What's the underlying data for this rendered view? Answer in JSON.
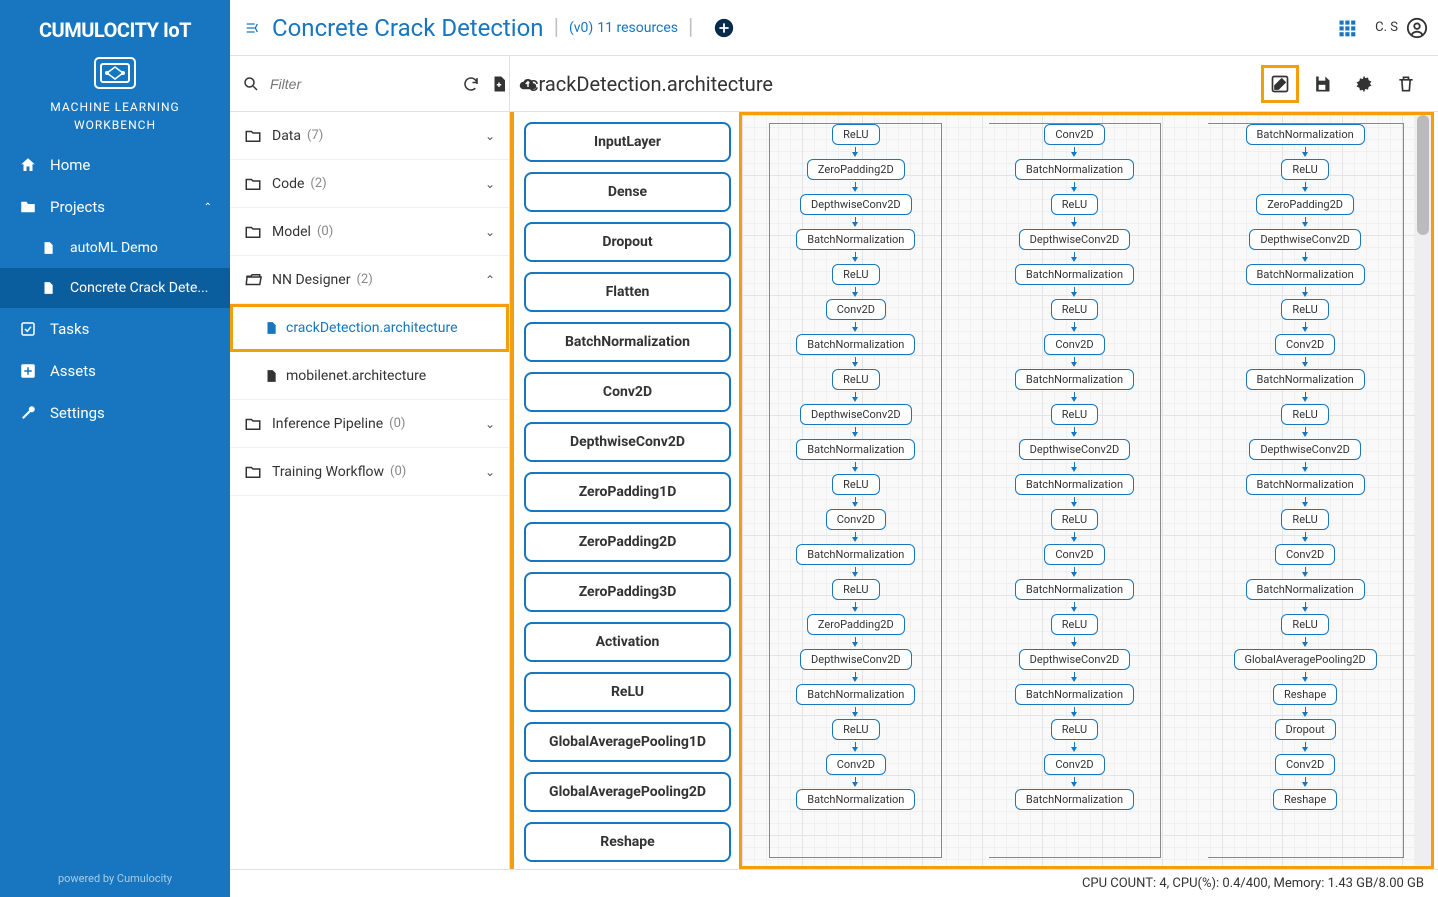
{
  "brand": {
    "line1": "CUMULOCITY",
    "line2": "IoT",
    "sub1": "MACHINE LEARNING",
    "sub2": "WORKBENCH"
  },
  "nav": {
    "home": "Home",
    "projects": "Projects",
    "project_items": [
      "autoML Demo",
      "Concrete Crack Dete..."
    ],
    "tasks": "Tasks",
    "assets": "Assets",
    "settings": "Settings"
  },
  "footer_credit": "powered by Cumulocity",
  "breadcrumb": {
    "title": "Concrete Crack Detection",
    "version": "(v0)",
    "resources": "11 resources"
  },
  "user": {
    "initials": "C. S"
  },
  "tree": {
    "filter_placeholder": "Filter",
    "folders": [
      {
        "label": "Data",
        "count": "(7)",
        "expanded": false
      },
      {
        "label": "Code",
        "count": "(2)",
        "expanded": false
      },
      {
        "label": "Model",
        "count": "(0)",
        "expanded": false
      },
      {
        "label": "NN Designer",
        "count": "(2)",
        "expanded": true,
        "children": [
          {
            "label": "crackDetection.architecture",
            "selected": true
          },
          {
            "label": "mobilenet.architecture",
            "selected": false
          }
        ]
      },
      {
        "label": "Inference Pipeline",
        "count": "(0)",
        "expanded": false
      },
      {
        "label": "Training Workflow",
        "count": "(0)",
        "expanded": false
      }
    ]
  },
  "editor": {
    "title": "crackDetection.architecture"
  },
  "palette": [
    "InputLayer",
    "Dense",
    "Dropout",
    "Flatten",
    "BatchNormalization",
    "Conv2D",
    "DepthwiseConv2D",
    "ZeroPadding1D",
    "ZeroPadding2D",
    "ZeroPadding3D",
    "Activation",
    "ReLU",
    "GlobalAveragePooling1D",
    "GlobalAveragePooling2D",
    "Reshape"
  ],
  "graph_columns": [
    [
      "ReLU",
      "ZeroPadding2D",
      "DepthwiseConv2D",
      "BatchNormalization",
      "ReLU",
      "Conv2D",
      "BatchNormalization",
      "ReLU",
      "DepthwiseConv2D",
      "BatchNormalization",
      "ReLU",
      "Conv2D",
      "BatchNormalization",
      "ReLU",
      "ZeroPadding2D",
      "DepthwiseConv2D",
      "BatchNormalization",
      "ReLU",
      "Conv2D",
      "BatchNormalization"
    ],
    [
      "Conv2D",
      "BatchNormalization",
      "ReLU",
      "DepthwiseConv2D",
      "BatchNormalization",
      "ReLU",
      "Conv2D",
      "BatchNormalization",
      "ReLU",
      "DepthwiseConv2D",
      "BatchNormalization",
      "ReLU",
      "Conv2D",
      "BatchNormalization",
      "ReLU",
      "DepthwiseConv2D",
      "BatchNormalization",
      "ReLU",
      "Conv2D",
      "BatchNormalization"
    ],
    [
      "BatchNormalization",
      "ReLU",
      "ZeroPadding2D",
      "DepthwiseConv2D",
      "BatchNormalization",
      "ReLU",
      "Conv2D",
      "BatchNormalization",
      "ReLU",
      "DepthwiseConv2D",
      "BatchNormalization",
      "ReLU",
      "Conv2D",
      "BatchNormalization",
      "ReLU",
      "GlobalAveragePooling2D",
      "Reshape",
      "Dropout",
      "Conv2D",
      "Reshape"
    ]
  ],
  "status": "CPU COUNT: 4, CPU(%): 0.4/400, Memory: 1.43 GB/8.00 GB"
}
